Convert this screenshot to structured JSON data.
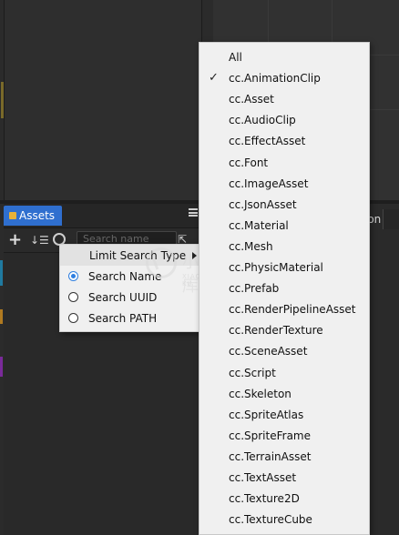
{
  "assets_panel": {
    "tab_label": "Assets",
    "add_glyph": "+",
    "sort_glyph": "↓☰",
    "search_placeholder": "Search name",
    "collapse_glyph": "⇱"
  },
  "right_panel": {
    "tab_label_fragment": "ion"
  },
  "context_menu": {
    "limit_label": "Limit Search Type",
    "options": [
      {
        "label": "Search Name",
        "selected": true
      },
      {
        "label": "Search UUID",
        "selected": false
      },
      {
        "label": "Search PATH",
        "selected": false
      }
    ]
  },
  "type_menu": {
    "check_glyph": "✓",
    "items": [
      {
        "label": "All",
        "checked": false
      },
      {
        "label": "cc.AnimationClip",
        "checked": true
      },
      {
        "label": "cc.Asset",
        "checked": false
      },
      {
        "label": "cc.AudioClip",
        "checked": false
      },
      {
        "label": "cc.EffectAsset",
        "checked": false
      },
      {
        "label": "cc.Font",
        "checked": false
      },
      {
        "label": "cc.ImageAsset",
        "checked": false
      },
      {
        "label": "cc.JsonAsset",
        "checked": false
      },
      {
        "label": "cc.Material",
        "checked": false
      },
      {
        "label": "cc.Mesh",
        "checked": false
      },
      {
        "label": "cc.PhysicMaterial",
        "checked": false
      },
      {
        "label": "cc.Prefab",
        "checked": false
      },
      {
        "label": "cc.RenderPipelineAsset",
        "checked": false
      },
      {
        "label": "cc.RenderTexture",
        "checked": false
      },
      {
        "label": "cc.SceneAsset",
        "checked": false
      },
      {
        "label": "cc.Script",
        "checked": false
      },
      {
        "label": "cc.Skeleton",
        "checked": false
      },
      {
        "label": "cc.SpriteAtlas",
        "checked": false
      },
      {
        "label": "cc.SpriteFrame",
        "checked": false
      },
      {
        "label": "cc.TerrainAsset",
        "checked": false
      },
      {
        "label": "cc.TextAsset",
        "checked": false
      },
      {
        "label": "cc.Texture2D",
        "checked": false
      },
      {
        "label": "cc.TextureCube",
        "checked": false
      }
    ]
  },
  "watermark": {
    "text": "小牛知识库",
    "subtext": "XIAO NIU ZHI SHI KU"
  },
  "colors": {
    "accent": "#2f7fe0",
    "tab_active": "#2f6fcf",
    "menu_bg": "#f0f0f0",
    "editor_bg": "#2b2b2b"
  }
}
